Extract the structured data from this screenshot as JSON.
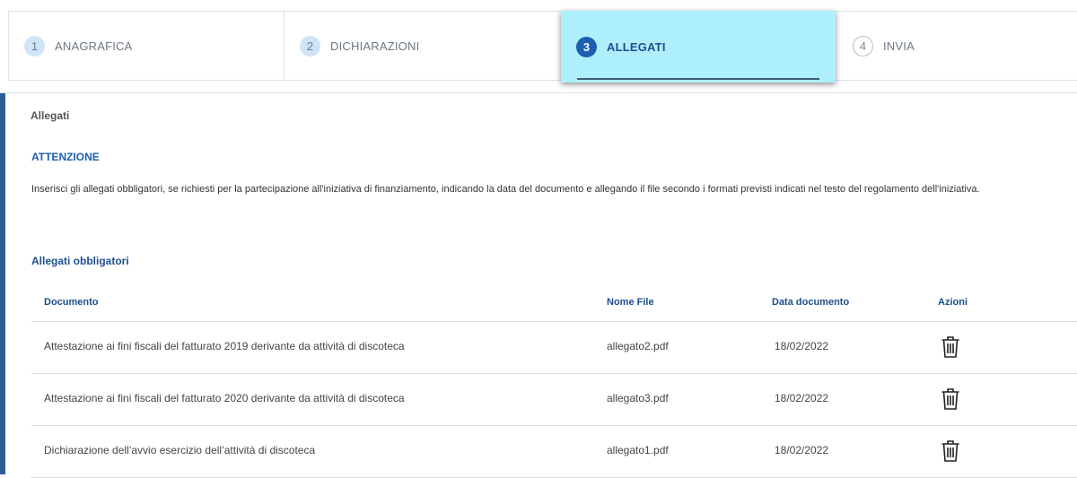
{
  "stepper": {
    "steps": [
      {
        "num": "1",
        "label": "ANAGRAFICA"
      },
      {
        "num": "2",
        "label": "DICHIARAZIONI"
      },
      {
        "num": "3",
        "label": "ALLEGATI"
      },
      {
        "num": "4",
        "label": "INVIA"
      }
    ],
    "active_step": 3
  },
  "content": {
    "section_title": "Allegati",
    "warning_title": "ATTENZIONE",
    "warning_text": "Inserisci gli allegati obbligatori, se richiesti per la partecipazione all'iniziativa di finanziamento, indicando la data del documento e allegando il file secondo i formati previsti indicati nel testo del regolamento dell'iniziativa.",
    "table_title": "Allegati obbligatori",
    "columns": [
      "Documento",
      "Nome File",
      "Data documento",
      "Azioni"
    ],
    "rows": [
      {
        "documento": "Attestazione ai fini fiscali del fatturato 2019 derivante da attività di discoteca",
        "file": "allegato2.pdf",
        "data": "18/02/2022",
        "action_icon": "trash-icon"
      },
      {
        "documento": "Attestazione ai fini fiscali del fatturato 2020 derivante da attività di discoteca",
        "file": "allegato3.pdf",
        "data": "18/02/2022",
        "action_icon": "trash-icon"
      },
      {
        "documento": "Dichiarazione dell’avvio esercizio dell’attività di discoteca",
        "file": "allegato1.pdf",
        "data": "18/02/2022",
        "action_icon": "trash-icon"
      }
    ]
  },
  "colors": {
    "accent": "#1d5fae",
    "active_step_bg": "#aeeffc",
    "left_rail": "#2e5f92"
  }
}
